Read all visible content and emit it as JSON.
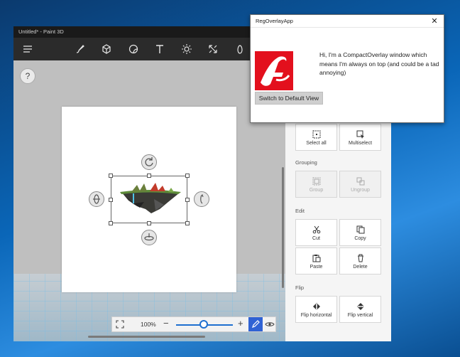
{
  "paint3d": {
    "window_title": "Untitled* - Paint 3D",
    "toolbar_icons": [
      "menu-icon",
      "brush-icon",
      "3d-shapes-icon",
      "stickers-icon",
      "text-icon",
      "effects-icon",
      "canvas-icon",
      "remix3d-icon"
    ],
    "help_label": "?",
    "zoom": {
      "value": "100%",
      "minus": "−",
      "plus": "+",
      "level": 0.5
    }
  },
  "panel": {
    "select_all": "Select all",
    "multiselect": "Multiselect",
    "grouping_label": "Grouping",
    "group": "Group",
    "ungroup": "Ungroup",
    "edit_label": "Edit",
    "cut": "Cut",
    "copy": "Copy",
    "paste": "Paste",
    "delete": "Delete",
    "flip_label": "Flip",
    "flip_horizontal": "Flip horizontal",
    "flip_vertical": "Flip vertical"
  },
  "overlay": {
    "title": "RegOverlayApp",
    "close": "✕",
    "message": "Hi, I'm a CompactOverlay window which means I'm always on top (and could be a tad annoying)",
    "button": "Switch to Default View"
  },
  "colors": {
    "accent": "#2f62d4",
    "logo_red": "#e3101d",
    "desktop_blue": "#0a66b8"
  }
}
